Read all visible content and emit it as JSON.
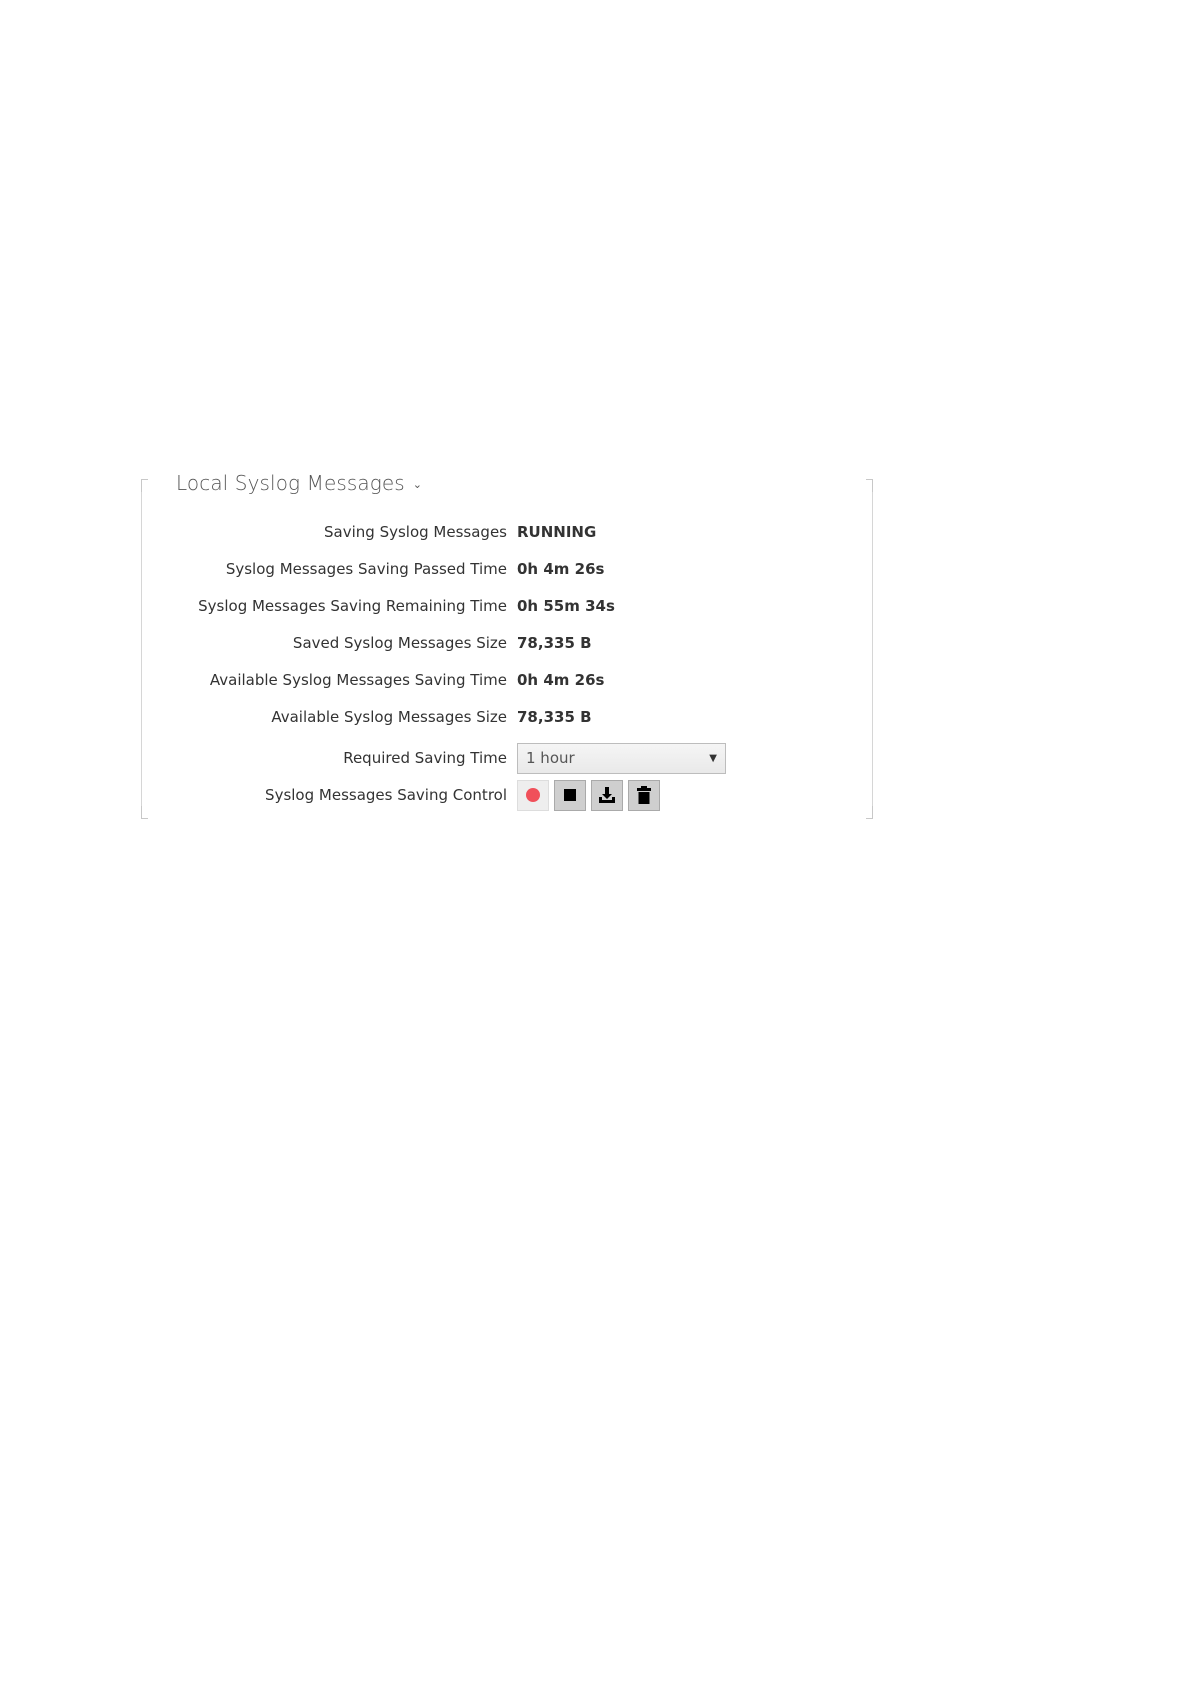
{
  "section": {
    "title": "Local Syslog Messages",
    "chevron_icon": "chevron-down-icon"
  },
  "rows": [
    {
      "label": "Saving Syslog Messages",
      "value": "RUNNING"
    },
    {
      "label": "Syslog Messages Saving Passed Time",
      "value": "0h 4m 26s"
    },
    {
      "label": "Syslog Messages Saving Remaining Time",
      "value": "0h 55m 34s"
    },
    {
      "label": "Saved Syslog Messages Size",
      "value": "78,335 B"
    },
    {
      "label": "Available Syslog Messages Saving Time",
      "value": "0h 4m 26s"
    },
    {
      "label": "Available Syslog Messages Size",
      "value": "78,335 B"
    }
  ],
  "required_saving_time": {
    "label": "Required Saving Time",
    "selected": "1 hour"
  },
  "control": {
    "label": "Syslog Messages Saving Control",
    "buttons": [
      "record-icon",
      "stop-icon",
      "download-icon",
      "trash-icon"
    ]
  },
  "colors": {
    "record": "#f0505a",
    "border": "#c8c8c8",
    "button_bg": "#cfcfcf"
  }
}
